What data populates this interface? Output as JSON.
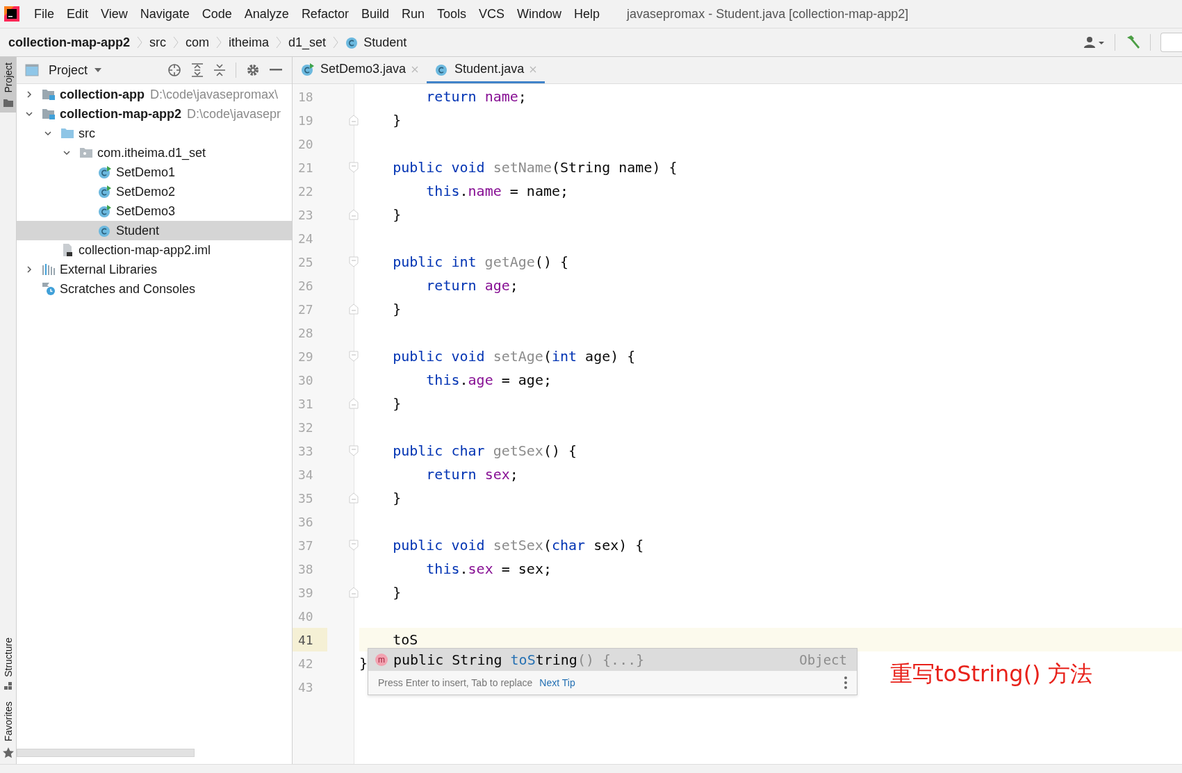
{
  "window": {
    "title": "javasepromax - Student.java [collection-map-app2]"
  },
  "menu": [
    "File",
    "Edit",
    "View",
    "Navigate",
    "Code",
    "Analyze",
    "Refactor",
    "Build",
    "Run",
    "Tools",
    "VCS",
    "Window",
    "Help"
  ],
  "breadcrumbs": [
    {
      "label": "collection-map-app2",
      "kind": "project"
    },
    {
      "label": "src",
      "kind": "folder"
    },
    {
      "label": "com",
      "kind": "folder"
    },
    {
      "label": "itheima",
      "kind": "folder"
    },
    {
      "label": "d1_set",
      "kind": "folder"
    },
    {
      "label": "Student",
      "kind": "class"
    }
  ],
  "tool_windows_top": [
    {
      "label": "Project",
      "kind": "project",
      "selected": true
    }
  ],
  "tool_windows_bottom": [
    {
      "label": "Structure",
      "kind": "structure",
      "selected": false
    },
    {
      "label": "Favorites",
      "kind": "favorites",
      "selected": false
    }
  ],
  "project": {
    "title": "Project",
    "tree": [
      {
        "label": "collection-app",
        "kind": "module",
        "path": "D:\\code\\javasepromax\\",
        "expanded": false,
        "selected": false
      },
      {
        "label": "collection-map-app2",
        "kind": "module",
        "path": "D:\\code\\javasepr",
        "expanded": true,
        "selected": false,
        "children": [
          {
            "label": "src",
            "kind": "folder",
            "expanded": true,
            "selected": false,
            "children": [
              {
                "label": "com.itheima.d1_set",
                "kind": "package",
                "expanded": true,
                "selected": false,
                "children": [
                  {
                    "label": "SetDemo1",
                    "kind": "class_runnable",
                    "selected": false
                  },
                  {
                    "label": "SetDemo2",
                    "kind": "class_runnable",
                    "selected": false
                  },
                  {
                    "label": "SetDemo3",
                    "kind": "class_runnable",
                    "selected": false
                  },
                  {
                    "label": "Student",
                    "kind": "class",
                    "selected": true
                  }
                ]
              }
            ]
          },
          {
            "label": "collection-map-app2.iml",
            "kind": "module_file",
            "selected": false
          }
        ]
      },
      {
        "label": "External Libraries",
        "kind": "libraries",
        "expanded": false,
        "selected": false
      },
      {
        "label": "Scratches and Consoles",
        "kind": "scratches",
        "selected": false
      }
    ]
  },
  "tabs": [
    {
      "label": "SetDemo3.java",
      "kind": "class_runnable",
      "selected": false
    },
    {
      "label": "Student.java",
      "kind": "class",
      "selected": true
    }
  ],
  "lines": [
    {
      "number": "18",
      "kind": "body",
      "current": false,
      "fold_start": false,
      "fold_end": false,
      "tokens": [
        {
          "kind": "keyword",
          "text": "return "
        },
        {
          "kind": "field",
          "text": "name"
        },
        {
          "kind": "plain",
          "text": ";"
        }
      ]
    },
    {
      "number": "19",
      "kind": "member",
      "current": false,
      "fold_start": false,
      "fold_end": true,
      "tokens": [
        {
          "kind": "plain",
          "text": "}"
        }
      ]
    },
    {
      "number": "20",
      "current": false,
      "fold_start": false,
      "fold_end": false
    },
    {
      "number": "21",
      "kind": "member",
      "current": false,
      "fold_start": true,
      "fold_end": false,
      "tokens": [
        {
          "kind": "keyword",
          "text": "public void "
        },
        {
          "kind": "unused",
          "text": "setName"
        },
        {
          "kind": "plain",
          "text": "(String name) {"
        }
      ]
    },
    {
      "number": "22",
      "kind": "body",
      "current": false,
      "fold_start": false,
      "fold_end": false,
      "tokens": [
        {
          "kind": "keyword",
          "text": "this"
        },
        {
          "kind": "plain",
          "text": "."
        },
        {
          "kind": "field",
          "text": "name"
        },
        {
          "kind": "plain",
          "text": " = name;"
        }
      ]
    },
    {
      "number": "23",
      "kind": "member",
      "current": false,
      "fold_start": false,
      "fold_end": true,
      "tokens": [
        {
          "kind": "plain",
          "text": "}"
        }
      ]
    },
    {
      "number": "24",
      "current": false,
      "fold_start": false,
      "fold_end": false
    },
    {
      "number": "25",
      "kind": "member",
      "current": false,
      "fold_start": true,
      "fold_end": false,
      "tokens": [
        {
          "kind": "keyword",
          "text": "public int "
        },
        {
          "kind": "unused",
          "text": "getAge"
        },
        {
          "kind": "plain",
          "text": "() {"
        }
      ]
    },
    {
      "number": "26",
      "kind": "body",
      "current": false,
      "fold_start": false,
      "fold_end": false,
      "tokens": [
        {
          "kind": "keyword",
          "text": "return "
        },
        {
          "kind": "field",
          "text": "age"
        },
        {
          "kind": "plain",
          "text": ";"
        }
      ]
    },
    {
      "number": "27",
      "kind": "member",
      "current": false,
      "fold_start": false,
      "fold_end": true,
      "tokens": [
        {
          "kind": "plain",
          "text": "}"
        }
      ]
    },
    {
      "number": "28",
      "current": false,
      "fold_start": false,
      "fold_end": false
    },
    {
      "number": "29",
      "kind": "member",
      "current": false,
      "fold_start": true,
      "fold_end": false,
      "tokens": [
        {
          "kind": "keyword",
          "text": "public void "
        },
        {
          "kind": "unused",
          "text": "setAge"
        },
        {
          "kind": "plain",
          "text": "("
        },
        {
          "kind": "keyword",
          "text": "int"
        },
        {
          "kind": "plain",
          "text": " age) {"
        }
      ]
    },
    {
      "number": "30",
      "kind": "body",
      "current": false,
      "fold_start": false,
      "fold_end": false,
      "tokens": [
        {
          "kind": "keyword",
          "text": "this"
        },
        {
          "kind": "plain",
          "text": "."
        },
        {
          "kind": "field",
          "text": "age"
        },
        {
          "kind": "plain",
          "text": " = age;"
        }
      ]
    },
    {
      "number": "31",
      "kind": "member",
      "current": false,
      "fold_start": false,
      "fold_end": true,
      "tokens": [
        {
          "kind": "plain",
          "text": "}"
        }
      ]
    },
    {
      "number": "32",
      "current": false,
      "fold_start": false,
      "fold_end": false
    },
    {
      "number": "33",
      "kind": "member",
      "current": false,
      "fold_start": true,
      "fold_end": false,
      "tokens": [
        {
          "kind": "keyword",
          "text": "public char "
        },
        {
          "kind": "unused",
          "text": "getSex"
        },
        {
          "kind": "plain",
          "text": "() {"
        }
      ]
    },
    {
      "number": "34",
      "kind": "body",
      "current": false,
      "fold_start": false,
      "fold_end": false,
      "tokens": [
        {
          "kind": "keyword",
          "text": "return "
        },
        {
          "kind": "field",
          "text": "sex"
        },
        {
          "kind": "plain",
          "text": ";"
        }
      ]
    },
    {
      "number": "35",
      "kind": "member",
      "current": false,
      "fold_start": false,
      "fold_end": true,
      "tokens": [
        {
          "kind": "plain",
          "text": "}"
        }
      ]
    },
    {
      "number": "36",
      "current": false,
      "fold_start": false,
      "fold_end": false
    },
    {
      "number": "37",
      "kind": "member",
      "current": false,
      "fold_start": true,
      "fold_end": false,
      "tokens": [
        {
          "kind": "keyword",
          "text": "public void "
        },
        {
          "kind": "unused",
          "text": "setSex"
        },
        {
          "kind": "plain",
          "text": "("
        },
        {
          "kind": "keyword",
          "text": "char"
        },
        {
          "kind": "plain",
          "text": " sex) {"
        }
      ]
    },
    {
      "number": "38",
      "kind": "body",
      "current": false,
      "fold_start": false,
      "fold_end": false,
      "tokens": [
        {
          "kind": "keyword",
          "text": "this"
        },
        {
          "kind": "plain",
          "text": "."
        },
        {
          "kind": "field",
          "text": "sex"
        },
        {
          "kind": "plain",
          "text": " = sex;"
        }
      ]
    },
    {
      "number": "39",
      "kind": "member",
      "current": false,
      "fold_start": false,
      "fold_end": true,
      "tokens": [
        {
          "kind": "plain",
          "text": "}"
        }
      ]
    },
    {
      "number": "40",
      "current": false,
      "fold_start": false,
      "fold_end": false
    },
    {
      "number": "41",
      "kind": "member",
      "current": true,
      "fold_start": false,
      "fold_end": false,
      "tokens": [
        {
          "kind": "plain",
          "text": "toS"
        }
      ]
    },
    {
      "number": "42",
      "kind": "top",
      "current": false,
      "fold_start": false,
      "fold_end": false,
      "tokens": [
        {
          "kind": "plain",
          "text": "}"
        }
      ]
    },
    {
      "number": "43",
      "current": false,
      "fold_start": false,
      "fold_end": false
    }
  ],
  "completion": {
    "items": [
      {
        "icon_letter": "m",
        "parts": [
          {
            "kind": "plain",
            "text": "public String "
          },
          {
            "kind": "match",
            "text": "toS"
          },
          {
            "kind": "plain",
            "text": "tring"
          },
          {
            "kind": "dim",
            "text": "() {...}"
          }
        ],
        "type": "Object",
        "selected": true
      }
    ],
    "hint": "Press Enter to insert, Tab to replace",
    "link": "Next Tip"
  },
  "annotation": "重写toString() 方法"
}
